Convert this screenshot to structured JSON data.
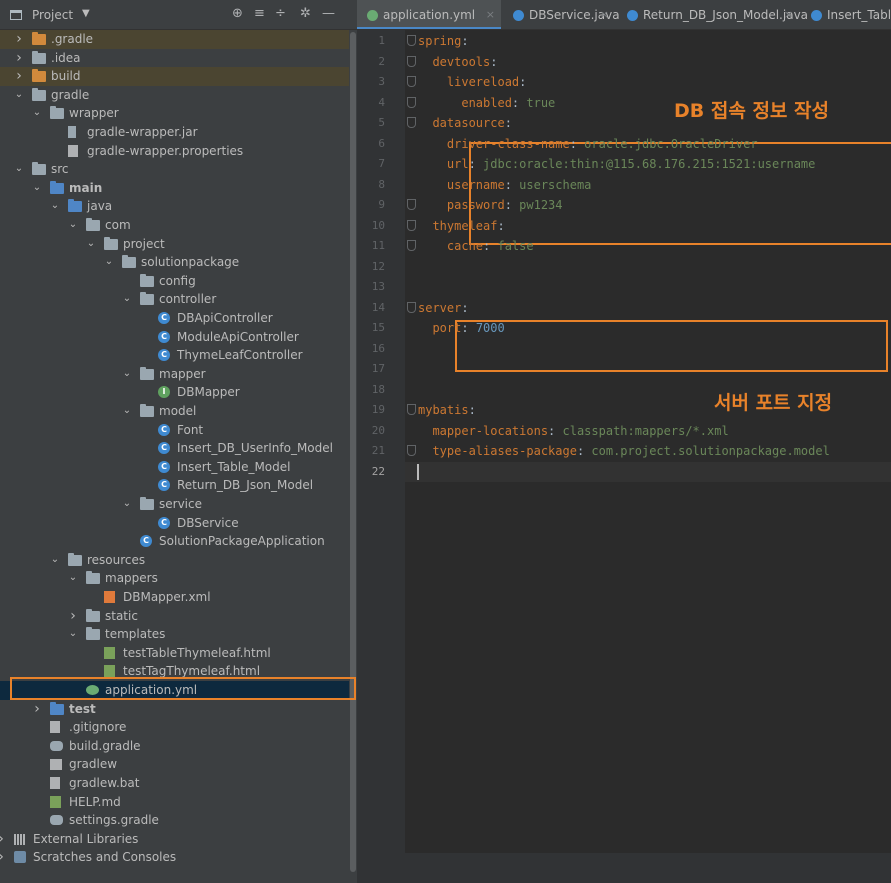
{
  "project_panel": {
    "title": "Project",
    "tree": [
      {
        "label": ".gradle",
        "arrow": ">",
        "icon": "folder-orange",
        "depth": 0,
        "excluded": true
      },
      {
        "label": ".idea",
        "arrow": ">",
        "icon": "folder",
        "depth": 0
      },
      {
        "label": "build",
        "arrow": ">",
        "icon": "folder-orange",
        "depth": 0,
        "excluded": true
      },
      {
        "label": "gradle",
        "arrow": "v",
        "icon": "folder",
        "depth": 0
      },
      {
        "label": "wrapper",
        "arrow": "v",
        "icon": "folder",
        "depth": 1
      },
      {
        "label": "gradle-wrapper.jar",
        "arrow": "",
        "icon": "jar",
        "depth": 2
      },
      {
        "label": "gradle-wrapper.properties",
        "arrow": "",
        "icon": "properties",
        "depth": 2
      },
      {
        "label": "src",
        "arrow": "v",
        "icon": "folder",
        "depth": 0
      },
      {
        "label": "main",
        "arrow": "v",
        "icon": "folder-module",
        "depth": 1,
        "bold": true
      },
      {
        "label": "java",
        "arrow": "v",
        "icon": "folder-src",
        "depth": 2
      },
      {
        "label": "com",
        "arrow": "v",
        "icon": "package",
        "depth": 3
      },
      {
        "label": "project",
        "arrow": "v",
        "icon": "package",
        "depth": 4
      },
      {
        "label": "solutionpackage",
        "arrow": "v",
        "icon": "package",
        "depth": 5
      },
      {
        "label": "config",
        "arrow": "",
        "icon": "package",
        "depth": 6
      },
      {
        "label": "controller",
        "arrow": "v",
        "icon": "package",
        "depth": 6
      },
      {
        "label": "DBApiController",
        "arrow": "",
        "icon": "class",
        "depth": 7
      },
      {
        "label": "ModuleApiController",
        "arrow": "",
        "icon": "class",
        "depth": 7
      },
      {
        "label": "ThymeLeafController",
        "arrow": "",
        "icon": "class",
        "depth": 7
      },
      {
        "label": "mapper",
        "arrow": "v",
        "icon": "package",
        "depth": 6
      },
      {
        "label": "DBMapper",
        "arrow": "",
        "icon": "interface",
        "depth": 7
      },
      {
        "label": "model",
        "arrow": "v",
        "icon": "package",
        "depth": 6
      },
      {
        "label": "Font",
        "arrow": "",
        "icon": "class",
        "depth": 7
      },
      {
        "label": "Insert_DB_UserInfo_Model",
        "arrow": "",
        "icon": "class",
        "depth": 7
      },
      {
        "label": "Insert_Table_Model",
        "arrow": "",
        "icon": "class",
        "depth": 7
      },
      {
        "label": "Return_DB_Json_Model",
        "arrow": "",
        "icon": "class",
        "depth": 7
      },
      {
        "label": "service",
        "arrow": "v",
        "icon": "package",
        "depth": 6
      },
      {
        "label": "DBService",
        "arrow": "",
        "icon": "class",
        "depth": 7
      },
      {
        "label": "SolutionPackageApplication",
        "arrow": "",
        "icon": "spring-class",
        "depth": 6
      },
      {
        "label": "resources",
        "arrow": "v",
        "icon": "folder-res",
        "depth": 2
      },
      {
        "label": "mappers",
        "arrow": "v",
        "icon": "folder",
        "depth": 3
      },
      {
        "label": "DBMapper.xml",
        "arrow": "",
        "icon": "xml",
        "depth": 4
      },
      {
        "label": "static",
        "arrow": ">",
        "icon": "folder",
        "depth": 3
      },
      {
        "label": "templates",
        "arrow": "v",
        "icon": "folder",
        "depth": 3
      },
      {
        "label": "testTableThymeleaf.html",
        "arrow": "",
        "icon": "html",
        "depth": 4
      },
      {
        "label": "testTagThymeleaf.html",
        "arrow": "",
        "icon": "html",
        "depth": 4
      },
      {
        "label": "application.yml",
        "arrow": "",
        "icon": "yml",
        "depth": 3,
        "selected": true
      },
      {
        "label": "test",
        "arrow": ">",
        "icon": "folder-test",
        "depth": 1,
        "bold": true
      },
      {
        "label": ".gitignore",
        "arrow": "",
        "icon": "file",
        "depth": 1
      },
      {
        "label": "build.gradle",
        "arrow": "",
        "icon": "gradle",
        "depth": 1
      },
      {
        "label": "gradlew",
        "arrow": "",
        "icon": "terminal",
        "depth": 1
      },
      {
        "label": "gradlew.bat",
        "arrow": "",
        "icon": "file",
        "depth": 1
      },
      {
        "label": "HELP.md",
        "arrow": "",
        "icon": "md",
        "depth": 1
      },
      {
        "label": "settings.gradle",
        "arrow": "",
        "icon": "gradle",
        "depth": 1
      },
      {
        "label": "External Libraries",
        "arrow": ">",
        "icon": "libraries",
        "depth": -1
      },
      {
        "label": "Scratches and Consoles",
        "arrow": ">",
        "icon": "scratch",
        "depth": -1
      }
    ]
  },
  "tabs": [
    {
      "label": "application.yml",
      "icon": "yml",
      "active": true
    },
    {
      "label": "DBService.java",
      "icon": "class"
    },
    {
      "label": "Return_DB_Json_Model.java",
      "icon": "class"
    },
    {
      "label": "Insert_Tabl",
      "icon": "class"
    }
  ],
  "code_lines": [
    [
      [
        "spring",
        "k"
      ],
      [
        ":",
        "p"
      ]
    ],
    [
      [
        "  devtools",
        "k"
      ],
      [
        ":",
        "p"
      ]
    ],
    [
      [
        "    livereload",
        "k"
      ],
      [
        ":",
        "p"
      ]
    ],
    [
      [
        "      enabled",
        "k"
      ],
      [
        ": ",
        "p"
      ],
      [
        "true",
        "v"
      ]
    ],
    [
      [
        "  datasource",
        "k"
      ],
      [
        ":",
        "p"
      ]
    ],
    [
      [
        "    driver-class-name",
        "k"
      ],
      [
        ": ",
        "p"
      ],
      [
        "oracle.jdbc.OracleDriver",
        "v"
      ]
    ],
    [
      [
        "    url",
        "k"
      ],
      [
        ": ",
        "p"
      ],
      [
        "jdbc:oracle:thin:@115.68.176.215:1521:username",
        "v"
      ]
    ],
    [
      [
        "    username",
        "k"
      ],
      [
        ": ",
        "p"
      ],
      [
        "userschema",
        "v"
      ]
    ],
    [
      [
        "    password",
        "k"
      ],
      [
        ": ",
        "p"
      ],
      [
        "pw1234",
        "v"
      ]
    ],
    [
      [
        "  thymeleaf",
        "k"
      ],
      [
        ":",
        "p"
      ]
    ],
    [
      [
        "    cache",
        "k"
      ],
      [
        ": ",
        "p"
      ],
      [
        "false",
        "v"
      ]
    ],
    [],
    [],
    [
      [
        "server",
        "k"
      ],
      [
        ":",
        "p"
      ]
    ],
    [
      [
        "  port",
        "k"
      ],
      [
        ": ",
        "p"
      ],
      [
        "7000",
        "n"
      ]
    ],
    [],
    [],
    [],
    [
      [
        "mybatis",
        "k"
      ],
      [
        ":",
        "p"
      ]
    ],
    [
      [
        "  mapper-locations",
        "k"
      ],
      [
        ": ",
        "p"
      ],
      [
        "classpath:mappers/*.xml",
        "v"
      ]
    ],
    [
      [
        "  type-aliases-package",
        "k"
      ],
      [
        ": ",
        "p"
      ],
      [
        "com.project.solutionpackage.model",
        "v"
      ]
    ],
    []
  ],
  "current_line": 22,
  "annotations": {
    "db_info": "DB 접속 정보 작성",
    "server_port": "서버 포트 지정"
  },
  "colors": {
    "highlight": "#e8822a",
    "key": "#cc7832",
    "string": "#6a8759",
    "number": "#6897bb"
  }
}
